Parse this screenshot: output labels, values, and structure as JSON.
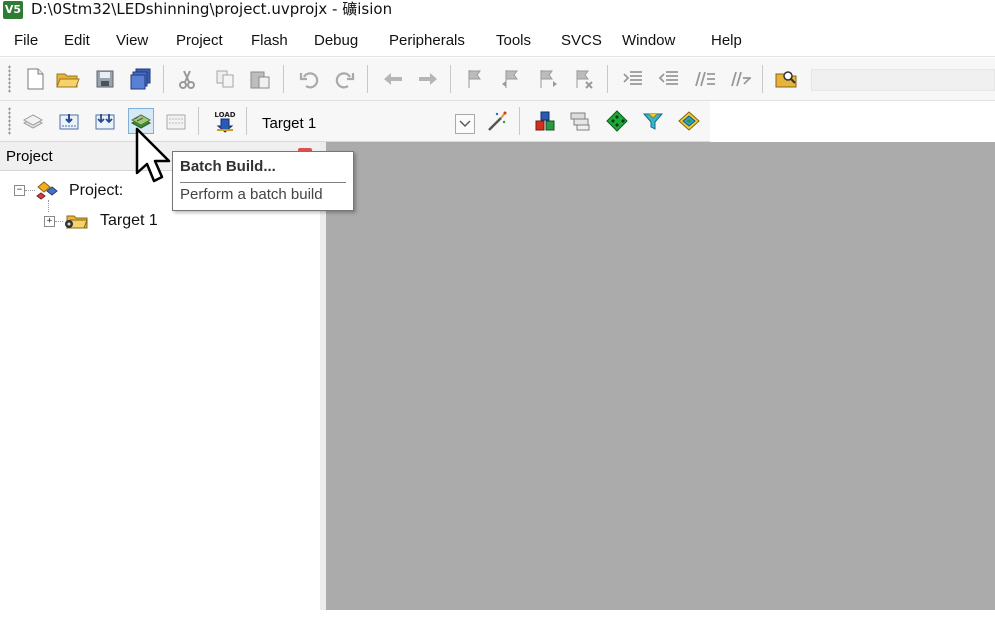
{
  "window": {
    "title": "D:\\0Stm32\\LEDshinning\\project.uvprojx - 礦ision",
    "app_icon_text": "V5"
  },
  "menu": {
    "items": [
      "File",
      "Edit",
      "View",
      "Project",
      "Flash",
      "Debug",
      "Peripherals",
      "Tools",
      "SVCS",
      "Window",
      "Help"
    ]
  },
  "toolbar1": {
    "icons": [
      "new-file-icon",
      "open-folder-icon",
      "save-icon",
      "save-all-icon",
      "cut-icon",
      "copy-icon",
      "paste-icon",
      "undo-icon",
      "redo-icon",
      "navigate-back-icon",
      "navigate-forward-icon",
      "bookmark-icon",
      "prev-bookmark-icon",
      "next-bookmark-icon",
      "clear-bookmarks-icon",
      "indent-icon",
      "unindent-icon",
      "comment-icon",
      "uncomment-icon",
      "find-in-files-icon"
    ]
  },
  "toolbar2": {
    "icons": [
      "translate-icon",
      "build-icon",
      "rebuild-icon",
      "batch-build-icon",
      "stop-build-icon",
      "download-icon",
      "target-options-icon",
      "manage-project-items-icon",
      "select-packs-icon",
      "manage-runtime-env-icon",
      "pack-installer-icon",
      "run-time-icon"
    ],
    "target_name": "Target 1",
    "load_label": "LOAD"
  },
  "project_panel": {
    "title": "Project",
    "root_label": "Project:",
    "target_label": "Target 1"
  },
  "tooltip": {
    "title": "Batch Build...",
    "description": "Perform a batch build"
  },
  "colors": {
    "editor_bg": "#ababab",
    "panel_header_bg": "#f0f0f0",
    "toolbar_bg": "#f7f7f7",
    "hover_bg": "#d7e8f7"
  }
}
